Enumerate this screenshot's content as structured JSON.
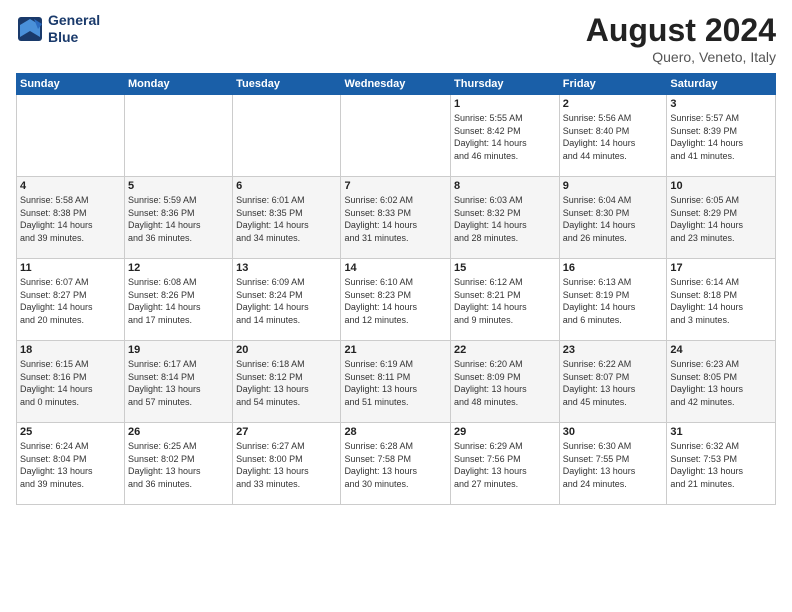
{
  "logo": {
    "line1": "General",
    "line2": "Blue"
  },
  "header": {
    "month": "August 2024",
    "location": "Quero, Veneto, Italy"
  },
  "weekdays": [
    "Sunday",
    "Monday",
    "Tuesday",
    "Wednesday",
    "Thursday",
    "Friday",
    "Saturday"
  ],
  "weeks": [
    [
      {
        "day": "",
        "info": ""
      },
      {
        "day": "",
        "info": ""
      },
      {
        "day": "",
        "info": ""
      },
      {
        "day": "",
        "info": ""
      },
      {
        "day": "1",
        "info": "Sunrise: 5:55 AM\nSunset: 8:42 PM\nDaylight: 14 hours\nand 46 minutes."
      },
      {
        "day": "2",
        "info": "Sunrise: 5:56 AM\nSunset: 8:40 PM\nDaylight: 14 hours\nand 44 minutes."
      },
      {
        "day": "3",
        "info": "Sunrise: 5:57 AM\nSunset: 8:39 PM\nDaylight: 14 hours\nand 41 minutes."
      }
    ],
    [
      {
        "day": "4",
        "info": "Sunrise: 5:58 AM\nSunset: 8:38 PM\nDaylight: 14 hours\nand 39 minutes."
      },
      {
        "day": "5",
        "info": "Sunrise: 5:59 AM\nSunset: 8:36 PM\nDaylight: 14 hours\nand 36 minutes."
      },
      {
        "day": "6",
        "info": "Sunrise: 6:01 AM\nSunset: 8:35 PM\nDaylight: 14 hours\nand 34 minutes."
      },
      {
        "day": "7",
        "info": "Sunrise: 6:02 AM\nSunset: 8:33 PM\nDaylight: 14 hours\nand 31 minutes."
      },
      {
        "day": "8",
        "info": "Sunrise: 6:03 AM\nSunset: 8:32 PM\nDaylight: 14 hours\nand 28 minutes."
      },
      {
        "day": "9",
        "info": "Sunrise: 6:04 AM\nSunset: 8:30 PM\nDaylight: 14 hours\nand 26 minutes."
      },
      {
        "day": "10",
        "info": "Sunrise: 6:05 AM\nSunset: 8:29 PM\nDaylight: 14 hours\nand 23 minutes."
      }
    ],
    [
      {
        "day": "11",
        "info": "Sunrise: 6:07 AM\nSunset: 8:27 PM\nDaylight: 14 hours\nand 20 minutes."
      },
      {
        "day": "12",
        "info": "Sunrise: 6:08 AM\nSunset: 8:26 PM\nDaylight: 14 hours\nand 17 minutes."
      },
      {
        "day": "13",
        "info": "Sunrise: 6:09 AM\nSunset: 8:24 PM\nDaylight: 14 hours\nand 14 minutes."
      },
      {
        "day": "14",
        "info": "Sunrise: 6:10 AM\nSunset: 8:23 PM\nDaylight: 14 hours\nand 12 minutes."
      },
      {
        "day": "15",
        "info": "Sunrise: 6:12 AM\nSunset: 8:21 PM\nDaylight: 14 hours\nand 9 minutes."
      },
      {
        "day": "16",
        "info": "Sunrise: 6:13 AM\nSunset: 8:19 PM\nDaylight: 14 hours\nand 6 minutes."
      },
      {
        "day": "17",
        "info": "Sunrise: 6:14 AM\nSunset: 8:18 PM\nDaylight: 14 hours\nand 3 minutes."
      }
    ],
    [
      {
        "day": "18",
        "info": "Sunrise: 6:15 AM\nSunset: 8:16 PM\nDaylight: 14 hours\nand 0 minutes."
      },
      {
        "day": "19",
        "info": "Sunrise: 6:17 AM\nSunset: 8:14 PM\nDaylight: 13 hours\nand 57 minutes."
      },
      {
        "day": "20",
        "info": "Sunrise: 6:18 AM\nSunset: 8:12 PM\nDaylight: 13 hours\nand 54 minutes."
      },
      {
        "day": "21",
        "info": "Sunrise: 6:19 AM\nSunset: 8:11 PM\nDaylight: 13 hours\nand 51 minutes."
      },
      {
        "day": "22",
        "info": "Sunrise: 6:20 AM\nSunset: 8:09 PM\nDaylight: 13 hours\nand 48 minutes."
      },
      {
        "day": "23",
        "info": "Sunrise: 6:22 AM\nSunset: 8:07 PM\nDaylight: 13 hours\nand 45 minutes."
      },
      {
        "day": "24",
        "info": "Sunrise: 6:23 AM\nSunset: 8:05 PM\nDaylight: 13 hours\nand 42 minutes."
      }
    ],
    [
      {
        "day": "25",
        "info": "Sunrise: 6:24 AM\nSunset: 8:04 PM\nDaylight: 13 hours\nand 39 minutes."
      },
      {
        "day": "26",
        "info": "Sunrise: 6:25 AM\nSunset: 8:02 PM\nDaylight: 13 hours\nand 36 minutes."
      },
      {
        "day": "27",
        "info": "Sunrise: 6:27 AM\nSunset: 8:00 PM\nDaylight: 13 hours\nand 33 minutes."
      },
      {
        "day": "28",
        "info": "Sunrise: 6:28 AM\nSunset: 7:58 PM\nDaylight: 13 hours\nand 30 minutes."
      },
      {
        "day": "29",
        "info": "Sunrise: 6:29 AM\nSunset: 7:56 PM\nDaylight: 13 hours\nand 27 minutes."
      },
      {
        "day": "30",
        "info": "Sunrise: 6:30 AM\nSunset: 7:55 PM\nDaylight: 13 hours\nand 24 minutes."
      },
      {
        "day": "31",
        "info": "Sunrise: 6:32 AM\nSunset: 7:53 PM\nDaylight: 13 hours\nand 21 minutes."
      }
    ]
  ]
}
